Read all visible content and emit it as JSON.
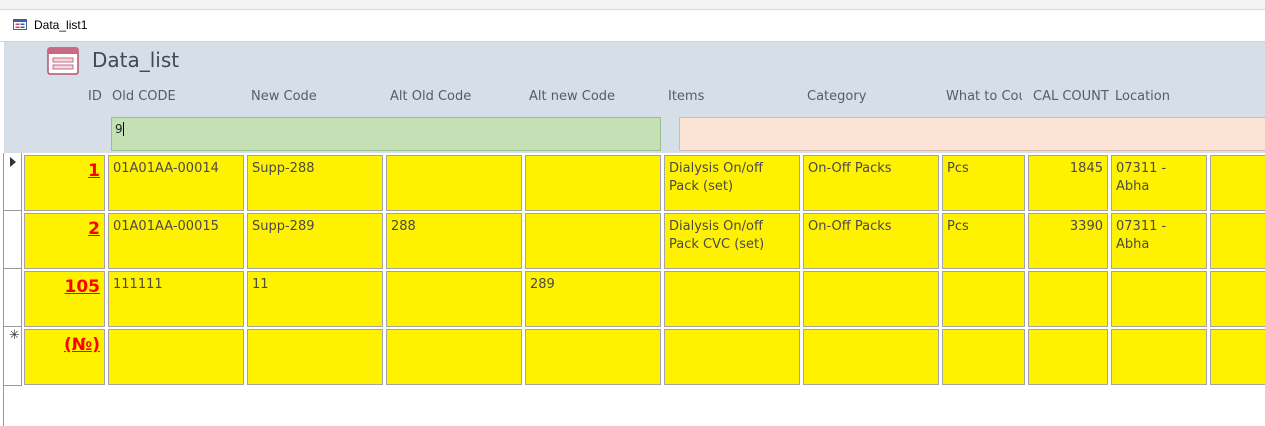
{
  "window": {
    "tab_title": "Data_list1"
  },
  "form": {
    "title": "Data_list"
  },
  "columns": [
    "ID",
    "Old CODE",
    "New Code",
    "Alt Old Code",
    "Alt new Code",
    "Items",
    "Category",
    "What to Cou",
    "CAL COUNT",
    "Location"
  ],
  "filter": {
    "green_value": "9",
    "pink_value": ""
  },
  "records": [
    {
      "id": "1",
      "old_code": "01A01AA-00014",
      "new_code": "Supp-288",
      "alt_old": "",
      "alt_new": "",
      "items": "Dialysis On/off Pack (set)",
      "category": "On-Off Packs",
      "what": "Pcs",
      "cal_count": "1845",
      "location": "07311 - Abha"
    },
    {
      "id": "2",
      "old_code": "01A01AA-00015",
      "new_code": "Supp-289",
      "alt_old": "288",
      "alt_new": "",
      "items": "Dialysis On/off Pack CVC (set)",
      "category": "On-Off Packs",
      "what": "Pcs",
      "cal_count": "3390",
      "location": "07311 - Abha"
    },
    {
      "id": "105",
      "old_code": "111111",
      "new_code": "11",
      "alt_old": "",
      "alt_new": "289",
      "items": "",
      "category": "",
      "what": "",
      "cal_count": "",
      "location": ""
    },
    {
      "id": "(№)",
      "old_code": "",
      "new_code": "",
      "alt_old": "",
      "alt_new": "",
      "items": "",
      "category": "",
      "what": "",
      "cal_count": "",
      "location": ""
    }
  ],
  "record_selectors": {
    "current": "arrow-icon",
    "new": "✳"
  },
  "colors": {
    "cell_bg": "#fff200",
    "id_text": "#ff0000",
    "header_bg": "#d6dfe8",
    "filter_green": "#c5e0b4",
    "filter_pink": "#fbe3d6"
  }
}
